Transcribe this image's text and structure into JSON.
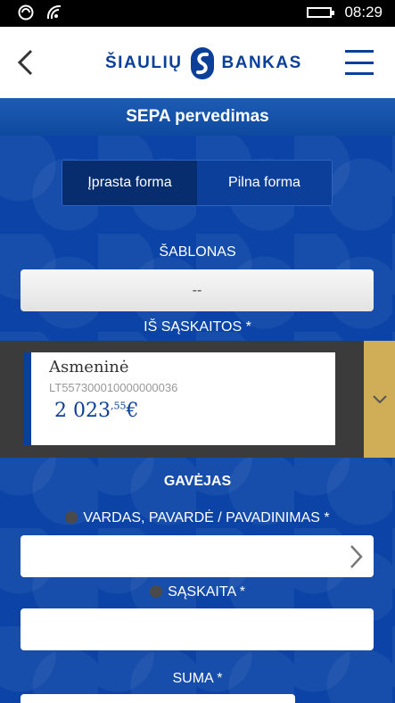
{
  "status_bar": {
    "time": "08:29",
    "icons": [
      "data-sync-icon",
      "wifi-icon",
      "battery-icon"
    ]
  },
  "header": {
    "logo_text_left": "ŠIAULIŲ",
    "logo_text_right": "BANKAS",
    "brand_color": "#0b3f9a"
  },
  "page": {
    "title": "SEPA pervedimas"
  },
  "tabs": [
    {
      "label": "Įprasta forma",
      "active": true
    },
    {
      "label": "Pilna forma",
      "active": false
    }
  ],
  "template": {
    "label": "ŠABLONAS",
    "value": "--"
  },
  "from_account": {
    "label": "IŠ SĄSKAITOS *",
    "name": "Asmeninė",
    "iban": "LT557300010000000036",
    "balance_main": "2 023",
    "balance_cents": ",55",
    "currency": "€"
  },
  "recipient": {
    "section_label": "GAVĖJAS",
    "name_label": "VARDAS, PAVARDĖ / PAVADINIMAS *",
    "name_value": "",
    "account_label": "SĄSKAITA *",
    "account_value": ""
  },
  "amount": {
    "label": "SUMA *",
    "value": ""
  }
}
